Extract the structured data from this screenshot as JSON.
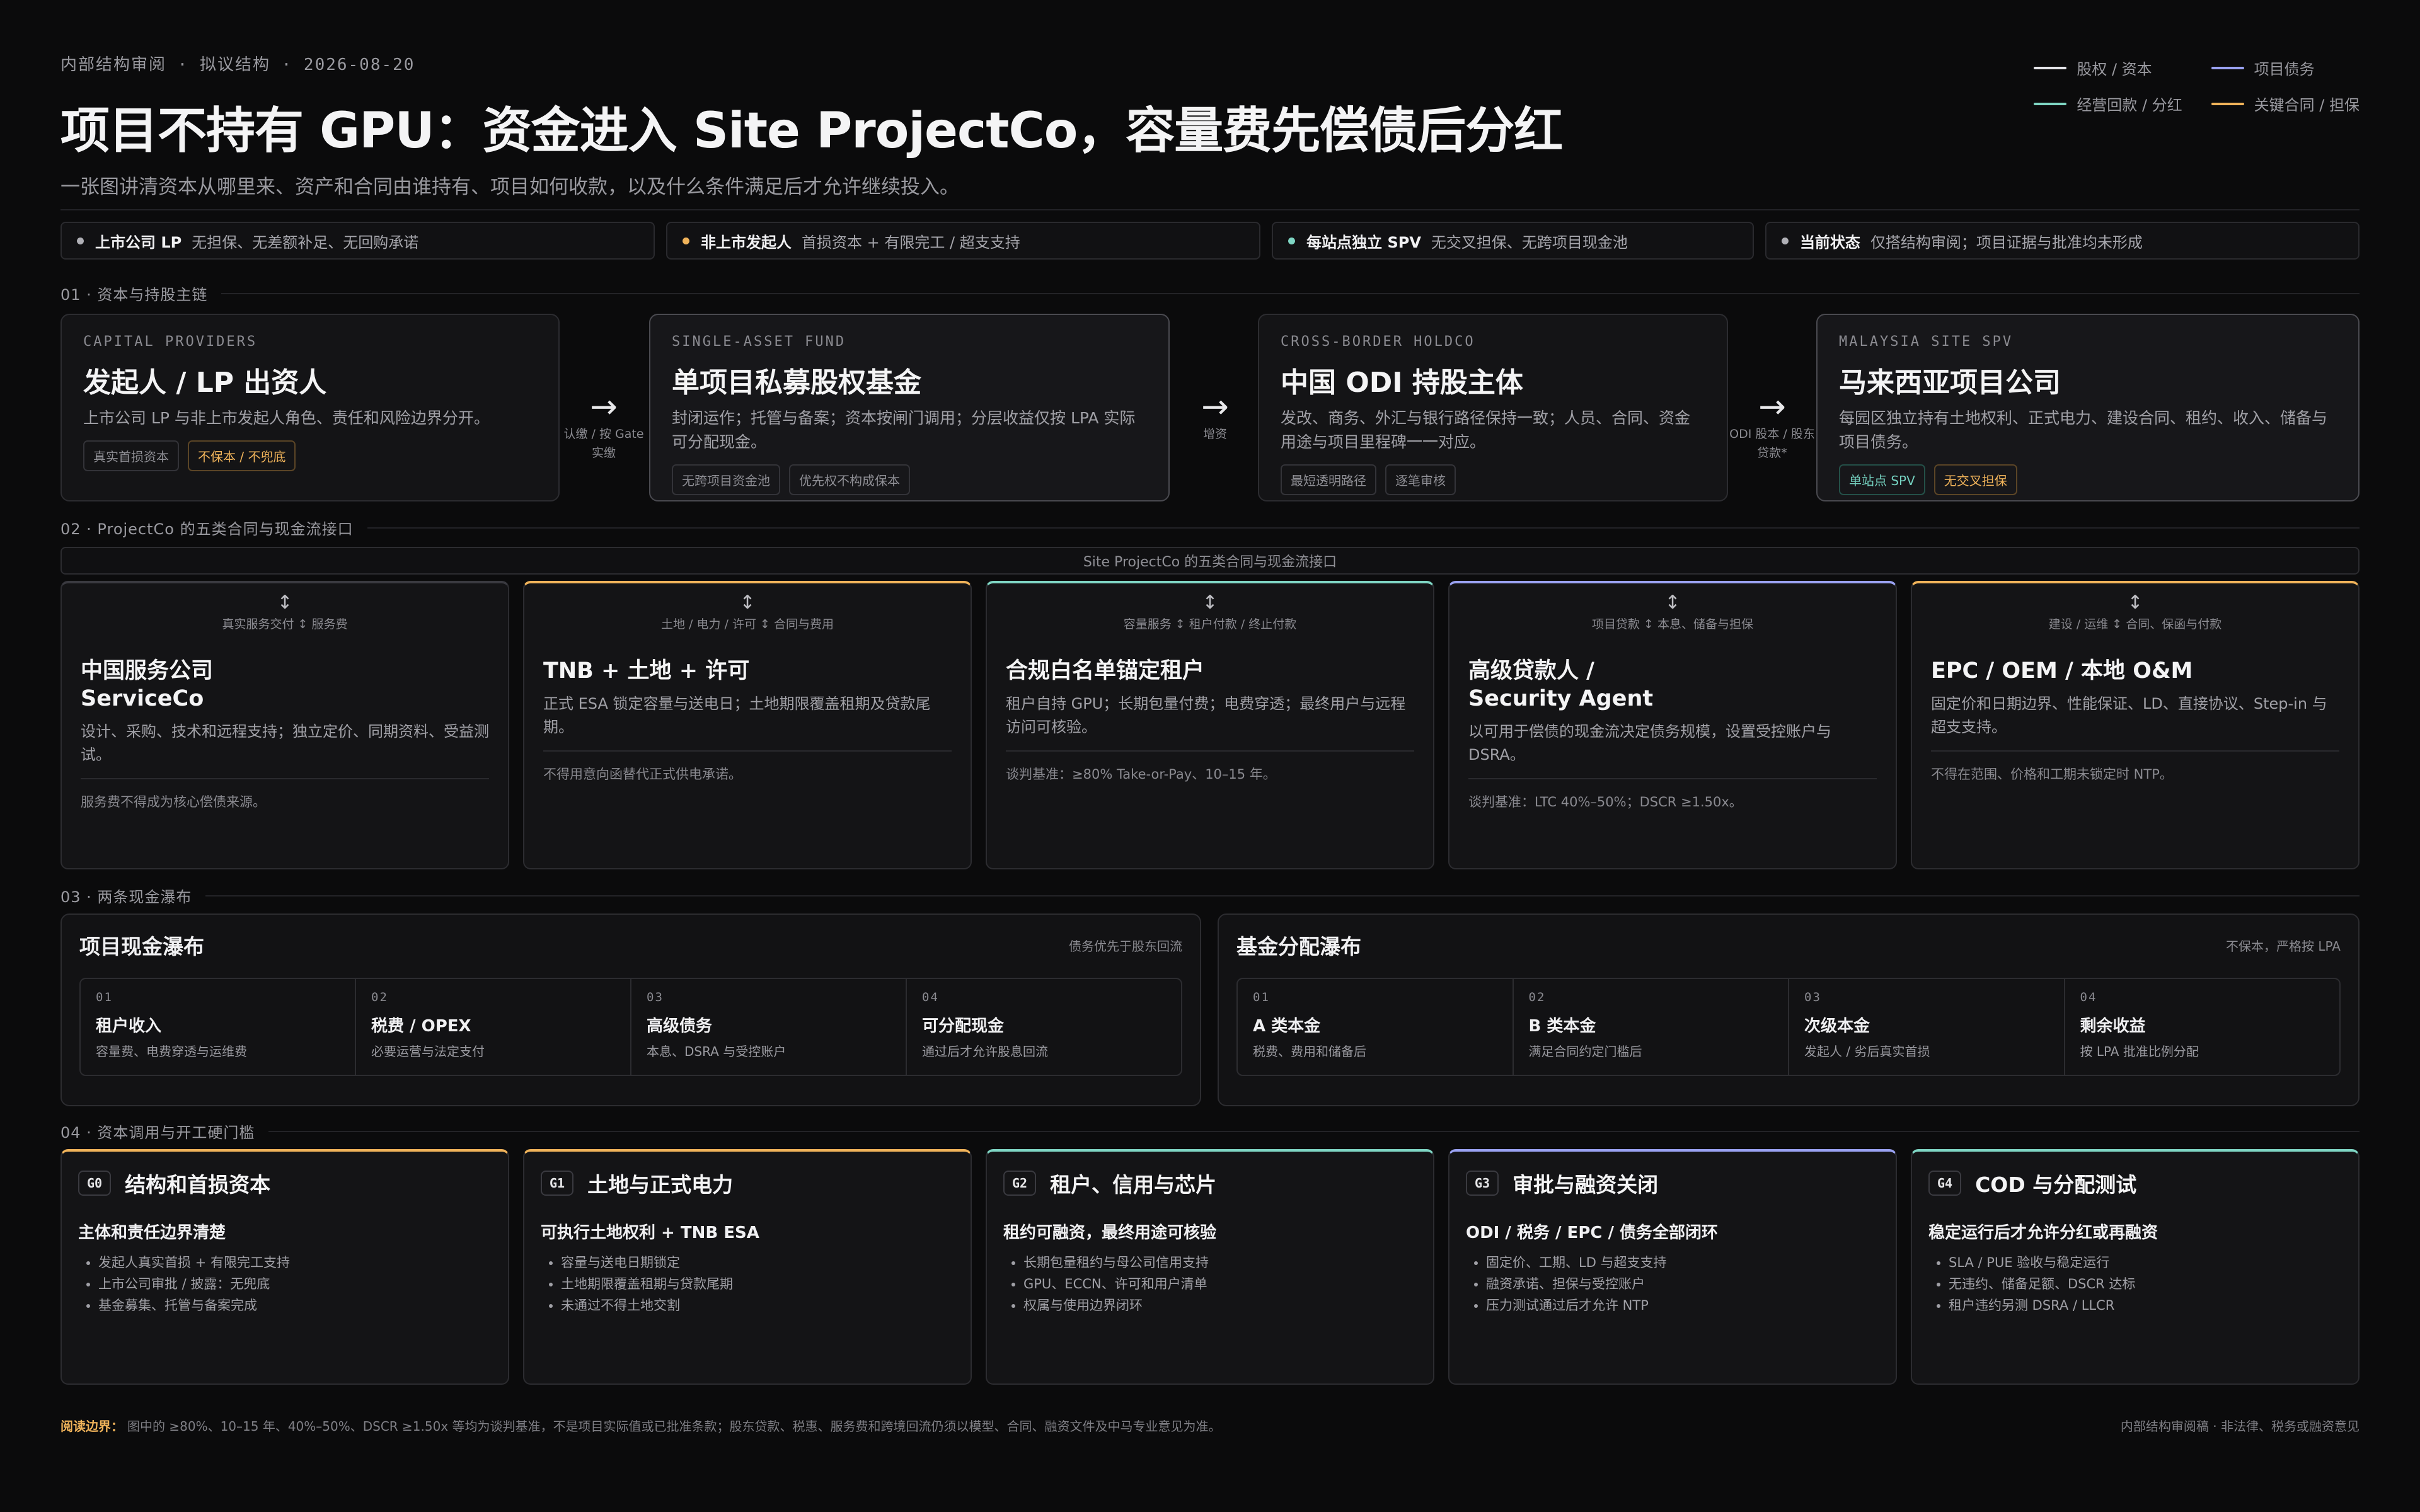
{
  "header": {
    "kicker": "内部结构审阅 · 拟议结构 · 2026-08-20",
    "title": "项目不持有 GPU：资金进入 Site ProjectCo，容量费先偿债后分红",
    "subtitle": "一张图讲清资本从哪里来、资产和合同由谁持有、项目如何收款，以及什么条件满足后才允许继续投入。"
  },
  "legend": [
    {
      "label": "股权 / 资本",
      "color": "#e6e6ea"
    },
    {
      "label": "项目债务",
      "color": "#9aa2f2"
    },
    {
      "label": "经营回款 / 分红",
      "color": "#7fd6c4"
    },
    {
      "label": "关键合同 / 担保",
      "color": "#f0b35a"
    }
  ],
  "strip": [
    {
      "bold": "上市公司 LP",
      "text": "无担保、无差额补足、无回购承诺",
      "color": "#b0b0b6"
    },
    {
      "bold": "非上市发起人",
      "text": "首损资本 + 有限完工 / 超支支持",
      "color": "#f0b35a"
    },
    {
      "bold": "每站点独立 SPV",
      "text": "无交叉担保、无跨项目现金池",
      "color": "#7fd6c4"
    },
    {
      "bold": "当前状态",
      "text": "仅搭结构审阅；项目证据与批准均未形成",
      "color": "#b0b0b6"
    }
  ],
  "sections": {
    "s1": "01 · 资本与持股主链",
    "s2": "02 · ProjectCo 的五类合同与现金流接口",
    "s3": "03 · 两条现金瀑布",
    "s4": "04 · 资本调用与开工硬门槛"
  },
  "chain": [
    {
      "tag": "CAPITAL PROVIDERS",
      "title": "发起人 / LP 出资人",
      "desc": "上市公司 LP 与非上市发起人角色、责任和风险边界分开。",
      "chips": [
        {
          "text": "真实首损资本",
          "tone": ""
        },
        {
          "text": "不保本 / 不兜底",
          "tone": "amber"
        }
      ]
    },
    {
      "tag": "SINGLE-ASSET FUND",
      "title": "单项目私募股权基金",
      "desc": "封闭运作；托管与备案；资本按闸门调用；分层收益仅按 LPA 实际可分配现金。",
      "chips": [
        {
          "text": "无跨项目资金池",
          "tone": ""
        },
        {
          "text": "优先权不构成保本",
          "tone": ""
        }
      ]
    },
    {
      "tag": "CROSS-BORDER HOLDCO",
      "title": "中国 ODI 持股主体",
      "desc": "发改、商务、外汇与银行路径保持一致；人员、合同、资金用途与项目里程碑一一对应。",
      "chips": [
        {
          "text": "最短透明路径",
          "tone": ""
        },
        {
          "text": "逐笔审核",
          "tone": ""
        }
      ]
    },
    {
      "tag": "MALAYSIA SITE SPV",
      "title": "马来西亚项目公司",
      "desc": "每园区独立持有土地权利、正式电力、建设合同、租约、收入、储备与项目债务。",
      "chips": [
        {
          "text": "单站点 SPV",
          "tone": "teal"
        },
        {
          "text": "无交叉担保",
          "tone": "amber"
        }
      ]
    }
  ],
  "arrows": [
    {
      "glyph": "→",
      "label1": "认缴 / 按 Gate",
      "label2": "实缴"
    },
    {
      "glyph": "→",
      "label1": "增资",
      "label2": ""
    },
    {
      "glyph": "→",
      "label1": "ODI 股本 / 股东",
      "label2": "贷款*"
    }
  ],
  "iface_bar": "Site ProjectCo 的五类合同与现金流接口",
  "interfaces": [
    {
      "arrow": "↕",
      "flow": "真实服务交付 ↕ 服务费",
      "title1": "中国服务公司",
      "title2": "ServiceCo",
      "desc": "设计、采购、技术和远程支持；独立定价、同期资料、受益测试。",
      "note": "服务费不得成为核心偿债来源。",
      "color": "#3a3a40"
    },
    {
      "arrow": "↕",
      "flow": "土地 / 电力 / 许可 ↕ 合同与费用",
      "title1": "TNB + 土地 + 许可",
      "title2": "",
      "desc": "正式 ESA 锁定容量与送电日；土地期限覆盖租期及贷款尾期。",
      "note": "不得用意向函替代正式供电承诺。",
      "color": "#f0b35a"
    },
    {
      "arrow": "↕",
      "flow": "容量服务 ↕ 租户付款 / 终止付款",
      "title1": "合规白名单锚定租户",
      "title2": "",
      "desc": "租户自持 GPU；长期包量付费；电费穿透；最终用户与远程访问可核验。",
      "note": "谈判基准：≥80% Take-or-Pay、10–15 年。",
      "color": "#7fd6c4"
    },
    {
      "arrow": "↕",
      "flow": "项目贷款 ↕ 本息、储备与担保",
      "title1": "高级贷款人 /",
      "title2": "Security Agent",
      "desc": "以可用于偿债的现金流决定债务规模，设置受控账户与 DSRA。",
      "note": "谈判基准：LTC 40%–50%；DSCR ≥1.50x。",
      "color": "#9aa2f2"
    },
    {
      "arrow": "↕",
      "flow": "建设 / 运维 ↕ 合同、保函与付款",
      "title1": "EPC / OEM / 本地 O&M",
      "title2": "",
      "desc": "固定价和日期边界、性能保证、LD、直接协议、Step-in 与超支支持。",
      "note": "不得在范围、价格和工期未锁定时 NTP。",
      "color": "#f0b35a"
    }
  ],
  "waterfalls": [
    {
      "title": "项目现金瀑布",
      "note": "债务优先于股东回流",
      "steps": [
        {
          "num": "01",
          "label": "租户收入",
          "sub": "容量费、电费穿透与运维费"
        },
        {
          "num": "02",
          "label": "税费 / OPEX",
          "sub": "必要运营与法定支付"
        },
        {
          "num": "03",
          "label": "高级债务",
          "sub": "本息、DSRA 与受控账户"
        },
        {
          "num": "04",
          "label": "可分配现金",
          "sub": "通过后才允许股息回流"
        }
      ]
    },
    {
      "title": "基金分配瀑布",
      "note": "不保本，严格按 LPA",
      "steps": [
        {
          "num": "01",
          "label": "A 类本金",
          "sub": "税费、费用和储备后"
        },
        {
          "num": "02",
          "label": "B 类本金",
          "sub": "满足合同约定门槛后"
        },
        {
          "num": "03",
          "label": "次级本金",
          "sub": "发起人 / 劣后真实首损"
        },
        {
          "num": "04",
          "label": "剩余收益",
          "sub": "按 LPA 批准比例分配"
        }
      ]
    }
  ],
  "gates": [
    {
      "badge": "G0",
      "title": "结构和首损资本",
      "sub": "主体和责任边界清楚",
      "items": [
        "发起人真实首损 + 有限完工支持",
        "上市公司审批 / 披露：无兜底",
        "基金募集、托管与备案完成"
      ],
      "color": "#f0b35a"
    },
    {
      "badge": "G1",
      "title": "土地与正式电力",
      "sub": "可执行土地权利 + TNB ESA",
      "items": [
        "容量与送电日期锁定",
        "土地期限覆盖租期与贷款尾期",
        "未通过不得土地交割"
      ],
      "color": "#f0b35a"
    },
    {
      "badge": "G2",
      "title": "租户、信用与芯片",
      "sub": "租约可融资，最终用途可核验",
      "items": [
        "长期包量租约与母公司信用支持",
        "GPU、ECCN、许可和用户清单",
        "权属与使用边界闭环"
      ],
      "color": "#7fd6c4"
    },
    {
      "badge": "G3",
      "title": "审批与融资关闭",
      "sub": "ODI / 税务 / EPC / 债务全部闭环",
      "items": [
        "固定价、工期、LD 与超支支持",
        "融资承诺、担保与受控账户",
        "压力测试通过后才允许 NTP"
      ],
      "color": "#9aa2f2"
    },
    {
      "badge": "G4",
      "title": "COD 与分配测试",
      "sub": "稳定运行后才允许分红或再融资",
      "items": [
        "SLA / PUE 验收与稳定运行",
        "无违约、储备足额、DSCR 达标",
        "租户违约另测 DSRA / LLCR"
      ],
      "color": "#7fd6c4"
    }
  ],
  "footer": {
    "key": "阅读边界：",
    "text": "图中的 ≥80%、10–15 年、40%–50%、DSCR ≥1.50x 等均为谈判基准，不是项目实际值或已批准条款；股东贷款、税惠、服务费和跨境回流仍须以模型、合同、融资文件及中马专业意见为准。",
    "right": "内部结构审阅稿 · 非法律、税务或融资意见"
  }
}
